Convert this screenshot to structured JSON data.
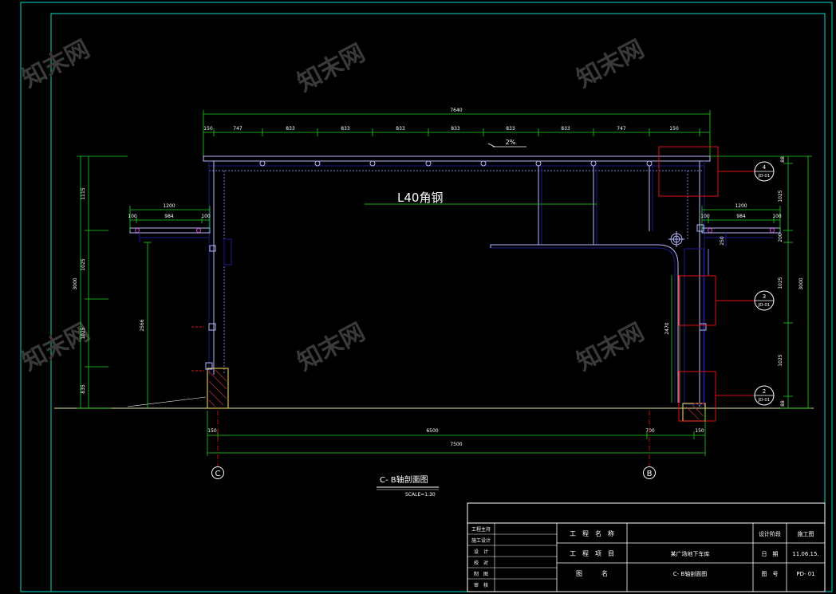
{
  "colors": {
    "background": "#000000",
    "frame": "#00d8c8",
    "outline": "#1a1a90",
    "dimension": "#1fd41f",
    "structure": "#b8b8ff",
    "callout": "#e01010",
    "text_white": "#ffffff",
    "fill_yellow": "#d8c040",
    "ground": "#e8e8a0"
  },
  "watermark": {
    "text": "知末网"
  },
  "drawing": {
    "overall_width": "7640",
    "top_segments": [
      "150",
      "747",
      "833",
      "833",
      "833",
      "833",
      "833",
      "833",
      "747",
      "150"
    ],
    "slope_label": "2%",
    "member_label": "L40角钢",
    "left_canopy": {
      "overall": "1200",
      "segments": [
        "100",
        "984",
        "100"
      ]
    },
    "right_canopy": {
      "overall": "1200",
      "segments": [
        "100",
        "984",
        "100"
      ]
    },
    "left_heights": {
      "total": "3000",
      "segments": [
        "1115",
        "1025",
        "1025",
        "835"
      ],
      "inner": "2566"
    },
    "right_heights": {
      "total": "3000",
      "segments": [
        "88",
        "1025",
        "1025",
        "1025",
        "88"
      ],
      "extra": [
        "250",
        "200"
      ]
    },
    "right_inner_height": "2470",
    "bottom_segments": [
      "150",
      "6500",
      "700",
      "150"
    ],
    "bottom_overall": "7500",
    "axis_left": "C",
    "axis_right": "B",
    "callouts": [
      {
        "number": "4",
        "ref": "JD-01"
      },
      {
        "number": "3",
        "ref": "JD-01"
      },
      {
        "number": "2",
        "ref": "JD-01"
      }
    ],
    "title": "C- B轴剖面图",
    "scale": "SCALE=1:30"
  },
  "title_block": {
    "left_rows": [
      "工程主持",
      "施工设计",
      "设　计",
      "校　对",
      "制　图",
      "审　核"
    ],
    "project_name_label": "工　程　名　称",
    "project_item_label": "工　程　项　目",
    "drawing_name_label": "图　　　名",
    "project_item_value": "某广场地下车库",
    "drawing_name_value": "C- B轴剖面图",
    "stage_label": "设计阶段",
    "stage_value": "施工图",
    "date_label": "日　期",
    "date_value": "11.06.15.",
    "number_label": "图　号",
    "number_value": "PD- 01"
  }
}
